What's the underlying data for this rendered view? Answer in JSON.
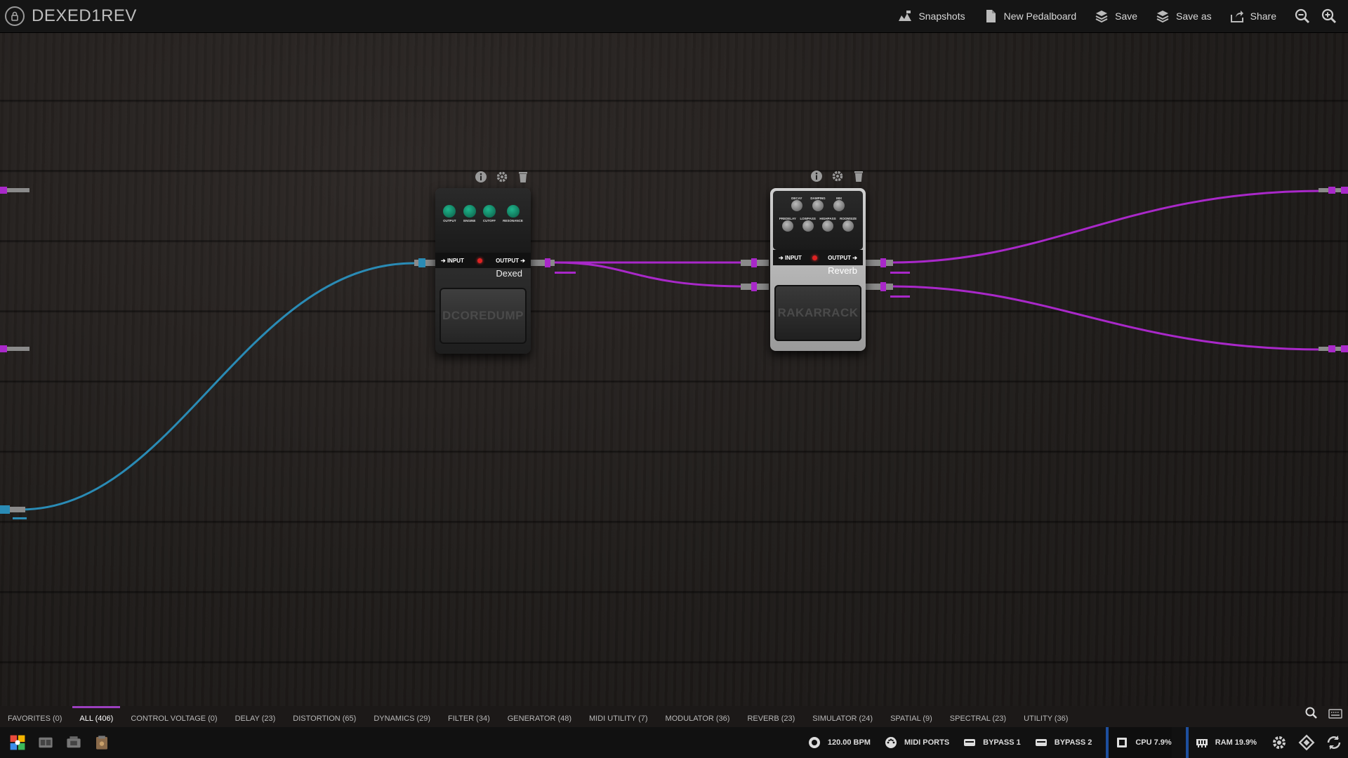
{
  "topbar": {
    "title": "DEXED1REV",
    "actions": [
      {
        "label": "Snapshots",
        "icon": "snapshots-icon"
      },
      {
        "label": "New Pedalboard",
        "icon": "new-document-icon"
      },
      {
        "label": "Save",
        "icon": "save-icon"
      },
      {
        "label": "Save as",
        "icon": "save-as-icon"
      },
      {
        "label": "Share",
        "icon": "share-icon"
      }
    ]
  },
  "pedals": [
    {
      "name": "Dexed",
      "brand": "DCOREDUMP",
      "input_label": "INPUT",
      "output_label": "OUTPUT",
      "knobs": [
        "OUTPUT",
        "ENGINE",
        "CUTOFF",
        "RESONANCE"
      ],
      "color": "#2b2b2b"
    },
    {
      "name": "Reverb",
      "brand": "RAKARRACK",
      "input_label": "INPUT",
      "output_label": "OUTPUT",
      "knobs_top": [
        "DECAY",
        "DAMPING",
        "MIX"
      ],
      "knobs_bottom": [
        "PREDELAY",
        "LOWPASS",
        "HIGHPASS",
        "ROOMSIZE"
      ],
      "color": "#b9b9b9"
    }
  ],
  "cable_colors": {
    "midi": "#2a8bb5",
    "audio": "#a928c9"
  },
  "categories": [
    {
      "label": "FAVORITES (0)",
      "active": false
    },
    {
      "label": "ALL (406)",
      "active": true
    },
    {
      "label": "CONTROL VOLTAGE (0)",
      "active": false
    },
    {
      "label": "DELAY (23)",
      "active": false
    },
    {
      "label": "DISTORTION (65)",
      "active": false
    },
    {
      "label": "DYNAMICS (29)",
      "active": false
    },
    {
      "label": "FILTER (34)",
      "active": false
    },
    {
      "label": "GENERATOR (48)",
      "active": false
    },
    {
      "label": "MIDI UTILITY (7)",
      "active": false
    },
    {
      "label": "MODULATOR (36)",
      "active": false
    },
    {
      "label": "REVERB (23)",
      "active": false
    },
    {
      "label": "SIMULATOR (24)",
      "active": false
    },
    {
      "label": "SPATIAL (9)",
      "active": false
    },
    {
      "label": "SPECTRAL (23)",
      "active": false
    },
    {
      "label": "UTILITY (36)",
      "active": false
    }
  ],
  "bottombar": {
    "tempo": "120.00 BPM",
    "midi_ports": "MIDI PORTS",
    "bypass1": "BYPASS 1",
    "bypass2": "BYPASS 2",
    "cpu": "CPU 7.9%",
    "ram": "RAM 19.9%"
  },
  "accent": "#9b3fbf"
}
